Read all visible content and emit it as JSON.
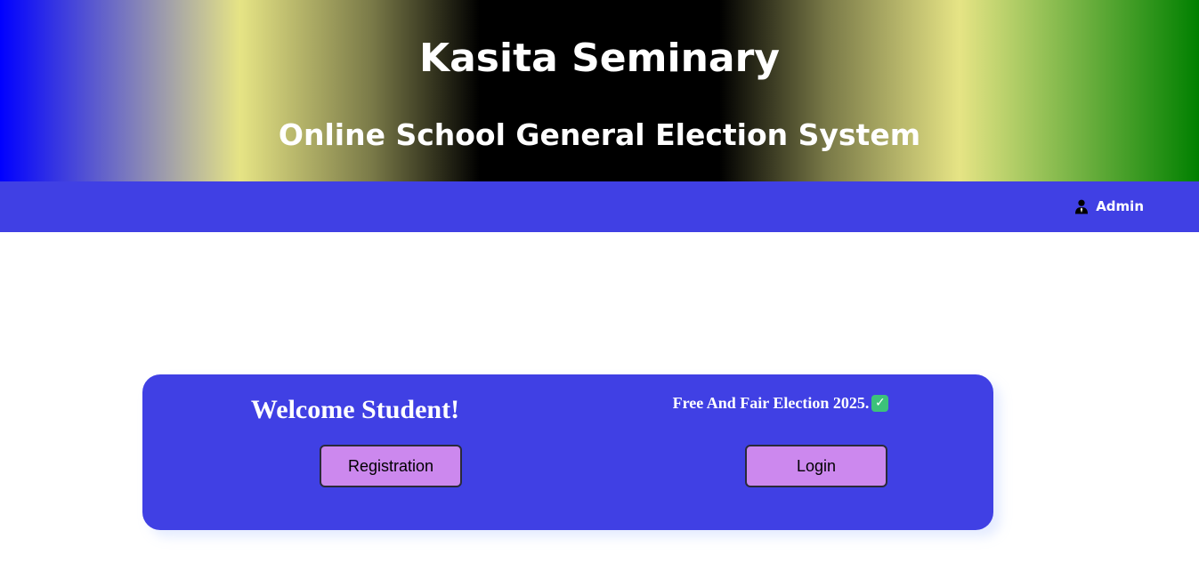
{
  "header": {
    "title": "Kasita Seminary",
    "subtitle": "Online School General Election System"
  },
  "navbar": {
    "admin_label": "Admin",
    "admin_icon": "user-tie-icon"
  },
  "card": {
    "welcome": "Welcome Student!",
    "tagline": "Free And Fair Election 2025.",
    "tagline_icon": "check-mark-button-icon",
    "check_glyph": "✓",
    "register_label": "Registration",
    "login_label": "Login"
  },
  "colors": {
    "nav_bg": "#4040e4",
    "card_bg": "#4040e4",
    "button_bg": "#cc88ee",
    "check_green": "#3cc27a"
  }
}
